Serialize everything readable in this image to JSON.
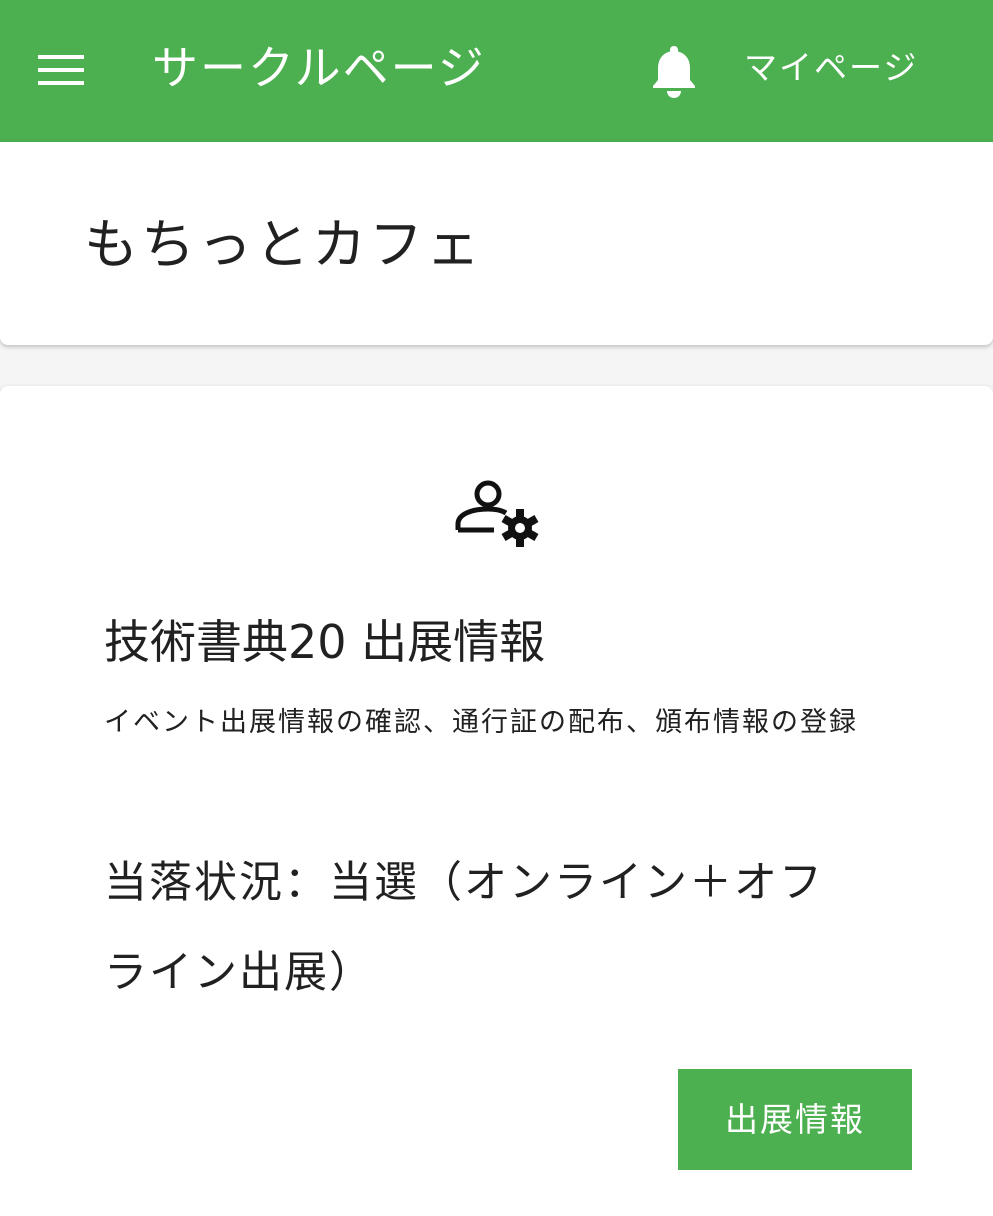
{
  "theme": {
    "accent": "#4caf50",
    "on_accent": "#ffffff",
    "text": "#212121",
    "surface": "#ffffff",
    "background": "#f5f5f5"
  },
  "appbar": {
    "menu_icon": "hamburger-menu-icon",
    "title": "サークルページ",
    "notification_icon": "bell-icon",
    "mypage_label": "マイページ"
  },
  "circle": {
    "name": "もちっとカフェ"
  },
  "event_card": {
    "icon": "user-gear-icon",
    "title": "技術書典20 出展情報",
    "description": "イベント出展情報の確認、通行証の配布、頒布情報の登録",
    "status": "当落状況：当選（オンライン＋オフライン出展）",
    "button_label": "出展情報"
  }
}
